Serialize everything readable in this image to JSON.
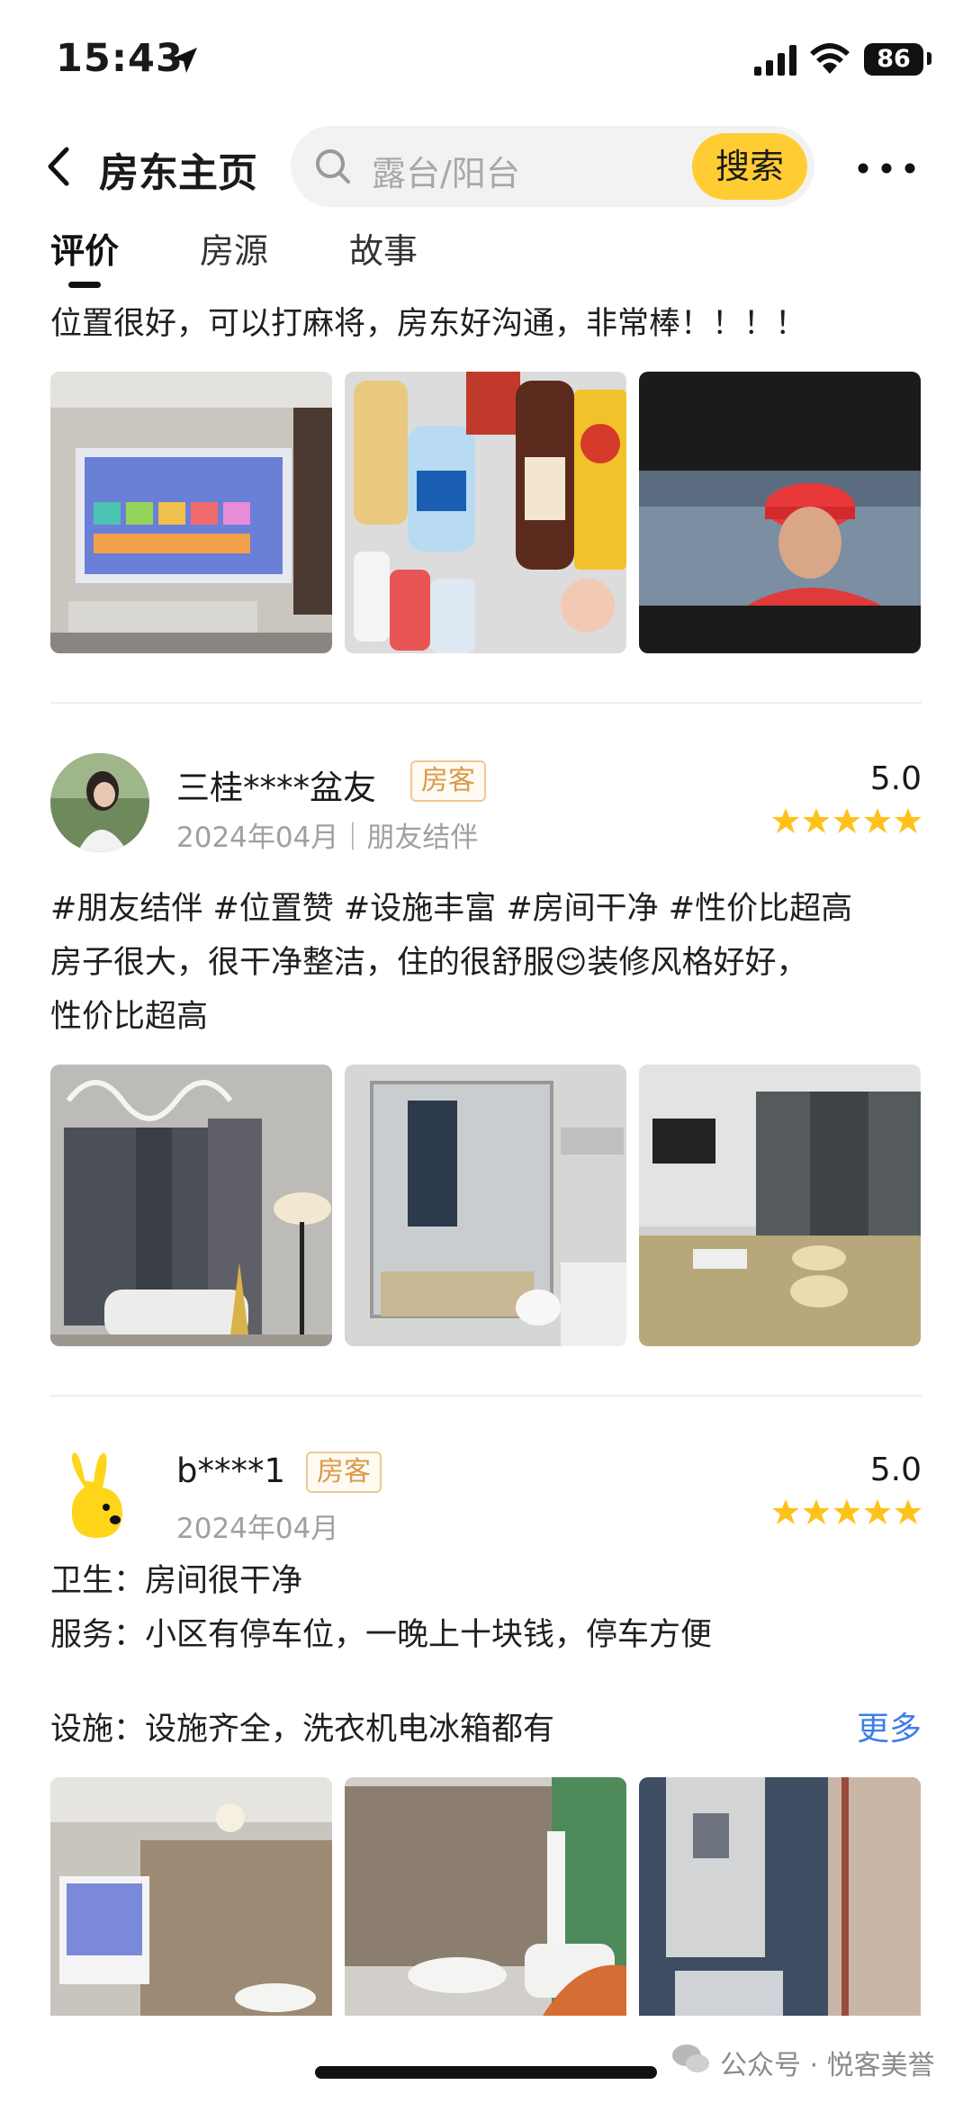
{
  "status_bar": {
    "time": "15:43",
    "battery": "86"
  },
  "nav": {
    "title": "房东主页",
    "search_placeholder": "露台/阳台",
    "search_button": "搜索"
  },
  "tabs": [
    {
      "label": "评价"
    },
    {
      "label": "房源"
    },
    {
      "label": "故事"
    }
  ],
  "reviews": [
    {
      "text": "位置很好，可以打麻将，房东好沟通，非常棒！！！！"
    },
    {
      "user": "三桂****盆友",
      "badge": "房客",
      "date": "2024年04月｜朋友结伴",
      "score": "5.0",
      "rating": 5,
      "text_lines": [
        "#朋友结伴 #位置赞 #设施丰富 #房间干净 #性价比超高",
        "房子很大，很干净整洁，住的很舒服😌装修风格好好，",
        "性价比超高"
      ]
    },
    {
      "user": "b****1",
      "badge": "房客",
      "date": "2024年04月",
      "score": "5.0",
      "rating": 5,
      "text_lines": [
        "卫生：房间很干净",
        "服务：小区有停车位，一晚上十块钱，停车方便"
      ],
      "facility_text": "设施：设施齐全，洗衣机电冰箱都有",
      "more_label": "更多"
    }
  ],
  "watermark": "公众号 · 悦客美誉",
  "colors": {
    "accent_yellow": "#ffcc33",
    "link_blue": "#3d7ee8",
    "star": "#ffc21a",
    "badge_text": "#d99b4a"
  }
}
